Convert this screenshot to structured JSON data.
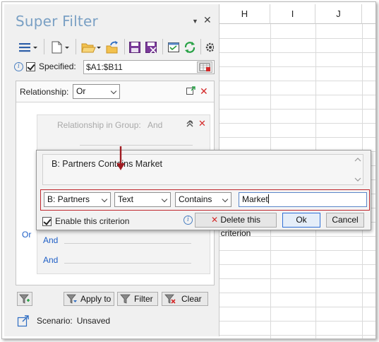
{
  "pane": {
    "title": "Super Filter",
    "dropdown_glyph": "▼",
    "close_glyph": "✕",
    "specified_label": "Specified:",
    "specified_checked": true,
    "range_value": "$A1:$B11",
    "relationship_label": "Relationship:",
    "relationship_value": "Or",
    "group_label": "Relationship in Group:",
    "group_value": "And",
    "or_label": "Or",
    "and_label_1": "And",
    "and_label_2": "And",
    "apply_label": "Apply to",
    "filter_label": "Filter",
    "clear_label": "Clear",
    "scenario_label": "Scenario:",
    "scenario_value": "Unsaved"
  },
  "popup": {
    "description": "B: Partners  Contains  Market",
    "column_select": "B: Partners",
    "type_select": "Text",
    "operator_select": "Contains",
    "value_input": "Market",
    "enable_label": "Enable this criterion",
    "enable_checked": true,
    "delete_label": "Delete this criterion",
    "ok_label": "Ok",
    "cancel_label": "Cancel"
  },
  "sheet": {
    "columns": [
      "H",
      "I",
      "J"
    ]
  },
  "colors": {
    "title": "#7aa0c4",
    "link_blue": "#1f5fc6",
    "criteria_border": "#c0262c",
    "delete_red": "#d42a2a",
    "arrow_red": "#a01c22"
  }
}
